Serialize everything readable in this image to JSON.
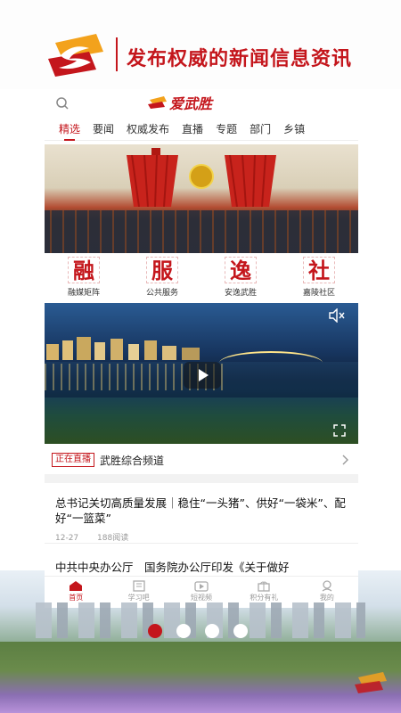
{
  "promo": {
    "title": "发布权威的新闻信息资讯"
  },
  "app": {
    "logo_text": "爱武胜"
  },
  "tabs": [
    "精选",
    "要闻",
    "权威发布",
    "直播",
    "专题",
    "部门",
    "乡镇"
  ],
  "quick_links": [
    {
      "glyph": "融",
      "label": "融媒矩阵"
    },
    {
      "glyph": "服",
      "label": "公共服务"
    },
    {
      "glyph": "逸",
      "label": "安逸武胜"
    },
    {
      "glyph": "社",
      "label": "嘉陵社区"
    }
  ],
  "live": {
    "badge": "正在直播",
    "title": "武胜综合频道"
  },
  "news": [
    {
      "title": "总书记关切高质量发展｜稳住“一头猪”、供好“一袋米”、配好“一篮菜”",
      "date": "12-27",
      "reads": "188阅读"
    },
    {
      "title": "中共中央办公厅　国务院办公厅印发《关于做好"
    }
  ],
  "bottom_nav": [
    {
      "label": "首页",
      "icon": "home-icon"
    },
    {
      "label": "学习吧",
      "icon": "book-icon"
    },
    {
      "label": "短视频",
      "icon": "video-icon"
    },
    {
      "label": "积分有礼",
      "icon": "gift-icon"
    },
    {
      "label": "我的",
      "icon": "user-icon"
    }
  ],
  "colors": {
    "brand": "#c4161c",
    "accent_yellow": "#f3a21c"
  }
}
